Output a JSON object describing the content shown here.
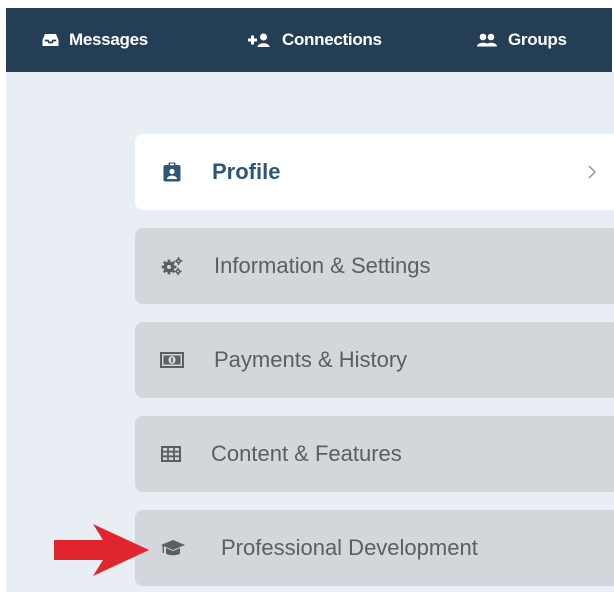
{
  "topnav": {
    "items": [
      {
        "label": "Messages",
        "icon": "inbox-icon"
      },
      {
        "label": "Connections",
        "icon": "add-user-icon"
      },
      {
        "label": "Groups",
        "icon": "group-icon"
      }
    ]
  },
  "sidebar": {
    "items": [
      {
        "label": "Profile",
        "icon": "badge-icon",
        "active": true,
        "chevron": "›"
      },
      {
        "label": "Information & Settings",
        "icon": "gears-icon",
        "active": false
      },
      {
        "label": "Payments & History",
        "icon": "money-icon",
        "active": false
      },
      {
        "label": "Content & Features",
        "icon": "table-icon",
        "active": false
      },
      {
        "label": "Professional Development",
        "icon": "graduation-cap-icon",
        "active": false
      }
    ]
  },
  "colors": {
    "topbar": "#243f55",
    "content_background": "#e9eef5",
    "menu_item": "#d3d6da",
    "active_item": "#ffffff",
    "active_text": "#2e5677",
    "inactive_text": "#5a5f63",
    "arrow": "#e0262c"
  }
}
